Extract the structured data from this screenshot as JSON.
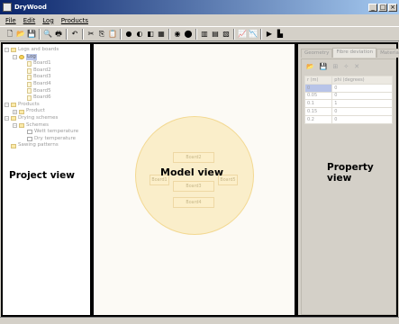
{
  "window": {
    "title": "DryWood",
    "controls": [
      "_",
      "□",
      "×"
    ]
  },
  "menu": [
    {
      "label": "File"
    },
    {
      "label": "Edit"
    },
    {
      "label": "Log"
    },
    {
      "label": "Products"
    }
  ],
  "toolbar": [
    {
      "icon": "new-icon",
      "glyph": "🗋"
    },
    {
      "icon": "open-icon",
      "glyph": "📂"
    },
    {
      "icon": "save-icon",
      "glyph": "💾"
    },
    {
      "sep": true
    },
    {
      "icon": "print-preview-icon",
      "glyph": "🔍"
    },
    {
      "icon": "print-icon",
      "glyph": "🖶"
    },
    {
      "sep": true
    },
    {
      "icon": "undo-icon",
      "glyph": "↶"
    },
    {
      "sep": true
    },
    {
      "icon": "cut-icon",
      "glyph": "✂"
    },
    {
      "icon": "copy-icon",
      "glyph": "⎘"
    },
    {
      "icon": "paste-icon",
      "glyph": "📋"
    },
    {
      "sep": true
    },
    {
      "icon": "log-add-icon",
      "glyph": "●"
    },
    {
      "icon": "log-rotate-icon",
      "glyph": "◐"
    },
    {
      "icon": "log-cut-icon",
      "glyph": "◧"
    },
    {
      "icon": "log-board-icon",
      "glyph": "▦"
    },
    {
      "sep": true
    },
    {
      "icon": "color-icon",
      "glyph": "◉"
    },
    {
      "icon": "circle-icon",
      "glyph": "⬤"
    },
    {
      "sep": true
    },
    {
      "icon": "board-a-icon",
      "glyph": "▥"
    },
    {
      "icon": "board-b-icon",
      "glyph": "▤"
    },
    {
      "icon": "board-c-icon",
      "glyph": "▧"
    },
    {
      "sep": true
    },
    {
      "icon": "chart-a-icon",
      "glyph": "📈"
    },
    {
      "icon": "chart-b-icon",
      "glyph": "📉"
    },
    {
      "sep": true
    },
    {
      "icon": "run-icon",
      "glyph": "▶"
    },
    {
      "icon": "results-icon",
      "glyph": "▙"
    }
  ],
  "tree": [
    {
      "label": "Logs and boards",
      "level": 0,
      "exp": "−",
      "icon": "folder"
    },
    {
      "label": "Log",
      "level": 1,
      "exp": "−",
      "icon": "round",
      "selected": true
    },
    {
      "label": "Board1",
      "level": 2,
      "icon": "doc"
    },
    {
      "label": "Board2",
      "level": 2,
      "icon": "doc"
    },
    {
      "label": "Board3",
      "level": 2,
      "icon": "doc"
    },
    {
      "label": "Board4",
      "level": 2,
      "icon": "doc"
    },
    {
      "label": "Board5",
      "level": 2,
      "icon": "doc"
    },
    {
      "label": "Board6",
      "level": 2,
      "icon": "doc"
    },
    {
      "label": "Products",
      "level": 0,
      "exp": "−",
      "icon": "folder"
    },
    {
      "label": "Product",
      "level": 1,
      "exp": "+",
      "icon": "folder"
    },
    {
      "label": "Drying schemes",
      "level": 0,
      "exp": "−",
      "icon": "folder"
    },
    {
      "label": "Schemes",
      "level": 1,
      "exp": "−",
      "icon": "folder"
    },
    {
      "label": "Wett temperature",
      "level": 2,
      "icon": "chart"
    },
    {
      "label": "Dry temperature",
      "level": 2,
      "icon": "chart"
    },
    {
      "label": "Sawing patterns",
      "level": 0,
      "icon": "folder"
    }
  ],
  "labels": {
    "project": "Project view",
    "model": "Model view",
    "property": "Property view"
  },
  "model": {
    "boards": [
      "Board2",
      "Board1",
      "Board3",
      "Board5",
      "Board4"
    ]
  },
  "property": {
    "tabs": [
      {
        "label": "Geometry"
      },
      {
        "label": "Fibre deviation",
        "active": true
      },
      {
        "label": "Material"
      }
    ],
    "tools": [
      {
        "icon": "open-icon",
        "glyph": "📂"
      },
      {
        "icon": "save-icon",
        "glyph": "💾"
      },
      {
        "icon": "add-row-icon",
        "glyph": "⊞"
      },
      {
        "icon": "wand-icon",
        "glyph": "✧"
      },
      {
        "icon": "delete-icon",
        "glyph": "✕"
      }
    ],
    "columns": [
      "r (m)",
      "phi (degrees)"
    ],
    "rows": [
      [
        "0",
        "0"
      ],
      [
        "0.05",
        "0"
      ],
      [
        "0.1",
        "1"
      ],
      [
        "0.15",
        "0"
      ],
      [
        "0.2",
        "0"
      ]
    ]
  }
}
